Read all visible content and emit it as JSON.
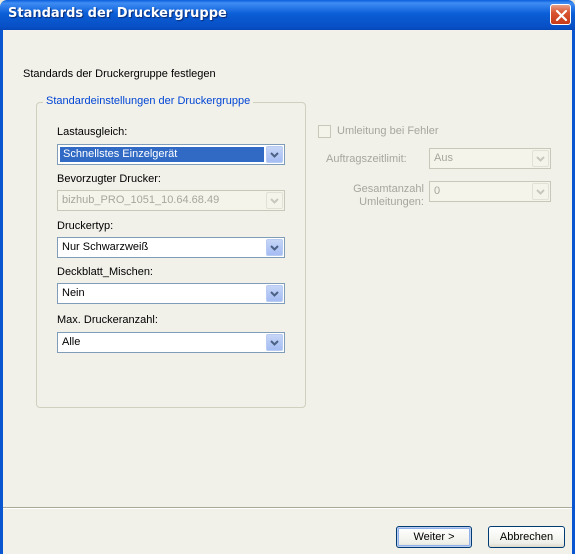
{
  "window": {
    "title": "Standards der Druckergruppe"
  },
  "heading": "Standards der Druckergruppe festlegen",
  "group": {
    "legend": "Standardeinstellungen der Druckergruppe",
    "load_balancing": {
      "label": "Lastausgleich:",
      "value": "Schnellstes Einzelgerät"
    },
    "preferred_printer": {
      "label": "Bevorzugter Drucker:",
      "value": "bizhub_PRO_1051_10.64.68.49"
    },
    "printer_type": {
      "label": "Druckertyp:",
      "value": "Nur Schwarzweiß"
    },
    "cover_mix": {
      "label": "Deckblatt_Mischen:",
      "value": "Nein"
    },
    "max_printers": {
      "label": "Max. Druckeranzahl:",
      "value": "Alle"
    }
  },
  "redirect": {
    "checkbox_label": "Umleitung bei Fehler",
    "timeout_label": "Auftragszeitlimit:",
    "timeout_value": "Aus",
    "total_label_line1": "Gesamtanzahl",
    "total_label_line2": "Umleitungen:",
    "total_value": "0"
  },
  "buttons": {
    "next": "Weiter >",
    "cancel": "Abbrechen"
  },
  "colors": {
    "titlebar": "#0a58d0",
    "accent_selection": "#316ac5",
    "group_legend": "#0046d5",
    "close_button": "#d9542f"
  }
}
